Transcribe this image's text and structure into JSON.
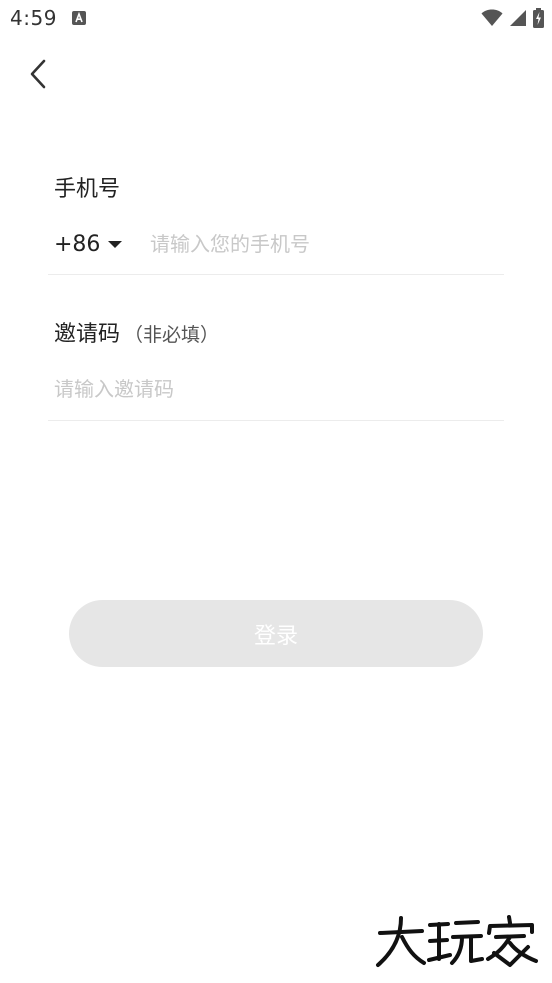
{
  "status_bar": {
    "time": "4:59",
    "notification_icon": "accessibility-a-icon",
    "wifi_icon": "wifi-icon",
    "signal_icon": "cell-signal-icon",
    "battery_icon": "battery-charging-icon"
  },
  "nav": {
    "back_icon": "chevron-left-icon"
  },
  "form": {
    "phone_label": "手机号",
    "country_code": "+86",
    "phone_placeholder": "请输入您的手机号",
    "phone_value": "",
    "invite_label": "邀请码",
    "invite_optional": "（非必填）",
    "invite_placeholder": "请输入邀请码",
    "invite_value": ""
  },
  "actions": {
    "login_label": "登录",
    "login_bg": "#e6e6e6",
    "login_text_color": "#ffffff"
  },
  "watermark": {
    "text": "大玩家"
  }
}
